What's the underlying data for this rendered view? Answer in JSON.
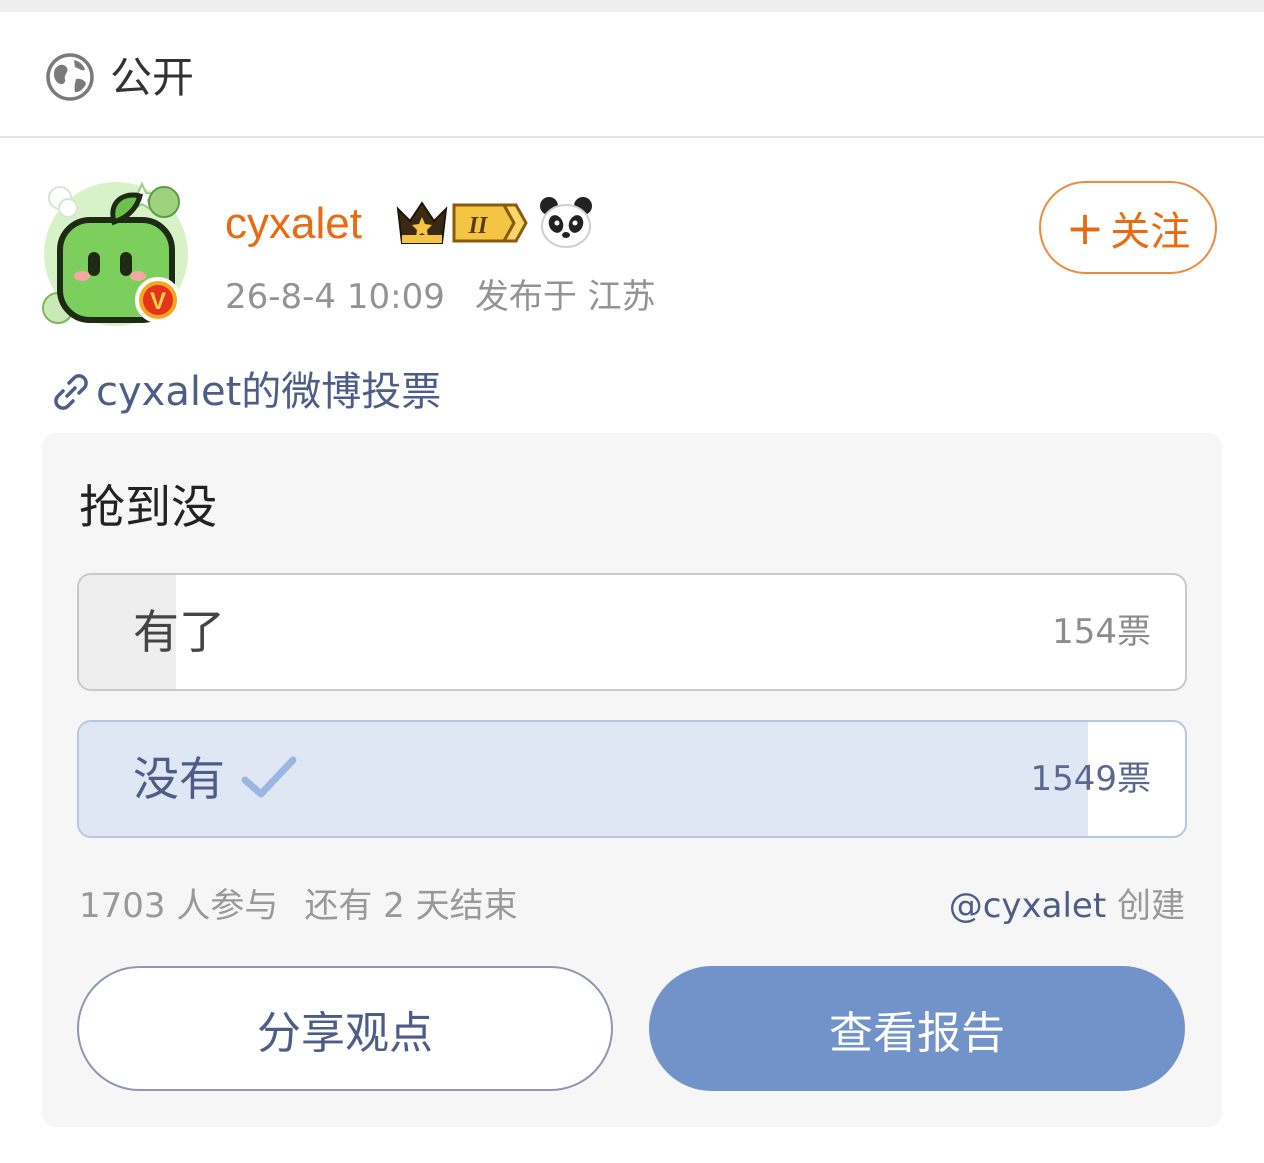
{
  "visibility": {
    "icon": "globe-icon",
    "label": "公开"
  },
  "post": {
    "author": {
      "username": "cyxalet",
      "badge_level": "II",
      "badges": [
        "crown-badge-icon",
        "panda-icon"
      ],
      "verified_icon": "verified-v-icon"
    },
    "datetime": "26-8-4 10:09",
    "location": "发布于 江苏",
    "follow_label": "关注",
    "follow_icon": "plus-icon",
    "vote_link": {
      "icon": "link-icon",
      "text": "cyxalet的微博投票"
    }
  },
  "poll": {
    "question": "抢到没",
    "options": [
      {
        "label": "有了",
        "votes": "154票",
        "share": 0.0877,
        "selected": false
      },
      {
        "label": "没有",
        "votes": "1549票",
        "share": 0.9123,
        "selected": true
      }
    ],
    "participants": "1703 人参与",
    "remaining": "还有 2 天结束",
    "creator_handle": "@cyxalet",
    "creator_suffix": " 创建",
    "share_button": "分享观点",
    "report_button": "查看报告"
  },
  "colors": {
    "accent_orange": "#e86b11",
    "link_blue": "#4e5d87",
    "primary_button": "#7293c9",
    "selected_fill": "#dfe6f4"
  }
}
